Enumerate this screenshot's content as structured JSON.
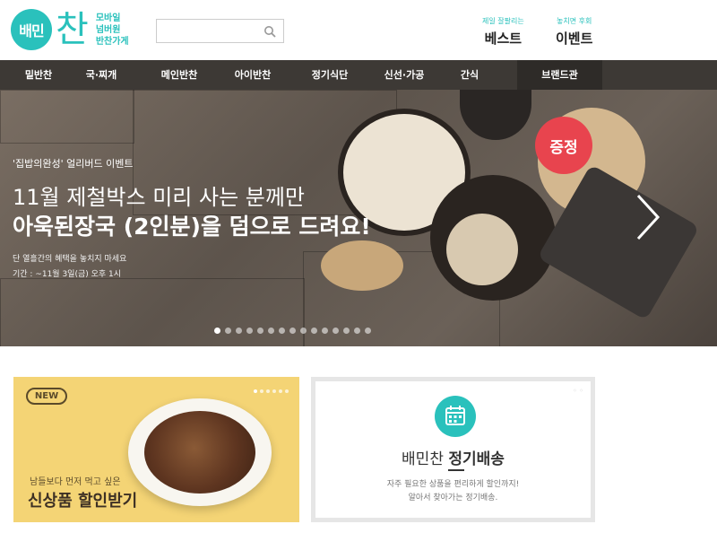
{
  "logo": {
    "circle_text": "배민",
    "chan_text": "찬",
    "tagline": [
      "모바일",
      "넘버원",
      "반찬가게"
    ]
  },
  "search": {
    "placeholder": ""
  },
  "header_links": [
    {
      "sub": "제일 잘팔리는",
      "main": "베스트"
    },
    {
      "sub": "놓치면 후회",
      "main": "이벤트"
    }
  ],
  "nav": [
    "밑반찬",
    "국·찌개",
    "메인반찬",
    "아이반찬",
    "정기식단",
    "신선·가공",
    "간식",
    "브랜드관"
  ],
  "hero": {
    "eyebrow": "'집밥의완성' 얼리버드 이벤트",
    "line1": "11월 제철박스 미리 사는 분께만",
    "line2": "아욱된장국 (2인분)을 덤으로 드려요!",
    "desc": "단 열흘간의 혜택을 놓치지 마세요",
    "period": "기간 : ~11월 3일(금) 오후 1시",
    "badge": "증정",
    "slide_count": 15,
    "active_slide": 0
  },
  "promo_left": {
    "badge": "NEW",
    "small": "남들보다 먼저 먹고 싶은",
    "big": "신상품 할인받기"
  },
  "promo_right": {
    "title_plain": "배민찬 ",
    "title_bold": "정기배송",
    "desc1": "자주 필요한 상품을 편리하게 할인까지!",
    "desc2": "알아서 찾아가는 정기배송."
  },
  "colors": {
    "brand": "#2ac1bc",
    "nav_bg": "#3d3935",
    "badge": "#e8444e",
    "promo_yellow": "#f4d475"
  }
}
